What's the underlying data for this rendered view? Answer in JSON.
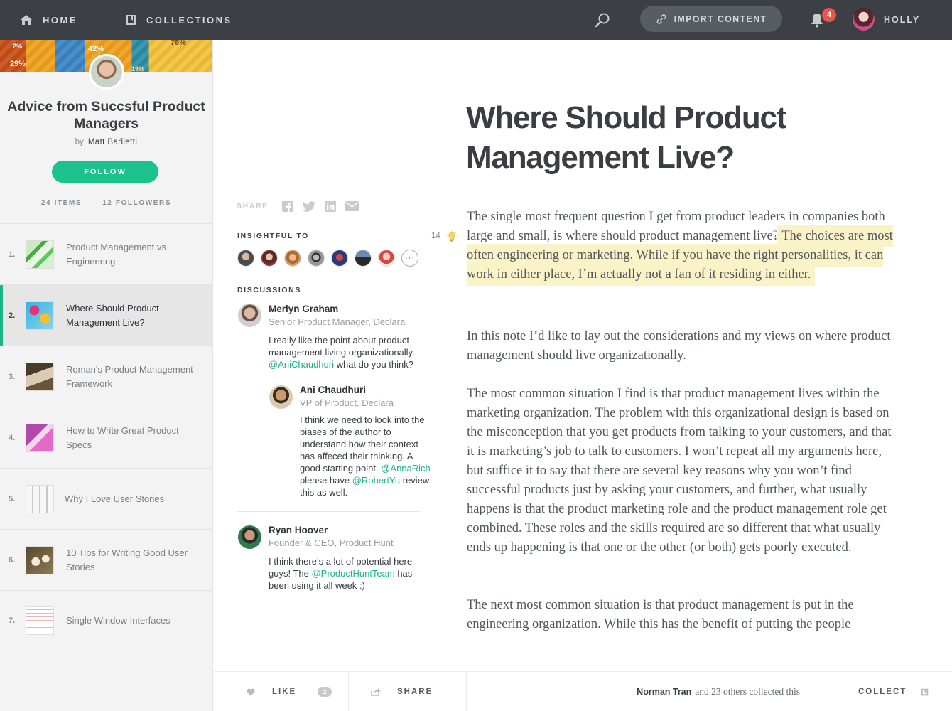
{
  "nav": {
    "home_label": "HOME",
    "collections_label": "COLLECTIONS",
    "import_label": "IMPORT CONTENT",
    "notification_count": "4",
    "user_name": "HOLLY"
  },
  "sidebar": {
    "cover_text": {
      "a": "2%",
      "b": "42%",
      "c": "29%",
      "d": "76%",
      "e": "19%"
    },
    "title": "Advice from Succsful Product Managers",
    "by_label": "by",
    "author": "Matt Bariletti",
    "follow_label": "FOLLOW",
    "items_count": "24 ITEMS",
    "followers_count": "12 FOLLOWERS",
    "items": [
      {
        "num": "1.",
        "label": "Product Management vs Engineering"
      },
      {
        "num": "2.",
        "label": "Where Should Product Management Live?"
      },
      {
        "num": "3.",
        "label": "Roman's Product Management Framework"
      },
      {
        "num": "4.",
        "label": "How to Write Great Product Specs"
      },
      {
        "num": "5.",
        "label": "Why I Love User Stories"
      },
      {
        "num": "6.",
        "label": "10 Tips for Writing Good User Stories"
      },
      {
        "num": "7.",
        "label": "Single Window Interfaces"
      }
    ]
  },
  "middle": {
    "share_label": "SHARE",
    "insightful_label": "INSIGHTFUL TO",
    "insight_count": "14",
    "more_label": "···",
    "discussions_label": "DISCUSSIONS",
    "comments": [
      {
        "name": "Merlyn Graham",
        "role": "Senior Product Manager, Declara",
        "text_before": "I really like the point about product management living organizationally. ",
        "mention1": "@AniChaudhuri",
        "text_after": " what do you think?"
      },
      {
        "name": "Ani Chaudhuri",
        "role": "VP of Product, Declara",
        "text_before": "I think we need to look into the biases of the author to understand how their context has affeced their thinking. A good starting point. ",
        "mention1": "@AnnaRich",
        "text_mid": " please have ",
        "mention2": "@RobertYu",
        "text_after": " review this as well."
      },
      {
        "name": "Ryan Hoover",
        "role": "Founder & CEO, Product Hunt",
        "text_before": "I think there’s a lot of potential here guys! The ",
        "mention1": "@ProductHuntTeam",
        "text_after": " has been using it all week :)"
      }
    ]
  },
  "article": {
    "title": "Where Should Product Management Live?",
    "p1_plain": "The single most frequent question I get from product leaders in companies both large and small, is where should product management live? ",
    "p1_highlight": "The choices are most often engineering or marketing. While if you have the right personalities, it can work in either place, I’m actually not a fan of it residing in either.",
    "p2": "In this note I’d like to lay out the considerations and my views on where product management should live organizationally.",
    "p3": "The most common situation I find is that product management lives within the marketing organization. The problem with this organizational design is based on the misconception that you get products from talking to your customers, and that it is marketing’s job to talk to customers. I won’t repeat all my arguments here, but suffice it to say that there are several key reasons why you won’t find successful products just by asking your customers, and further, what usually happens is that the product marketing role and the product management role get combined. These roles and the skills required are so different that what usually ends up happening is that one or the other (or both) gets poorly executed.",
    "p4": "The next most common situation is that product management is put in the engineering organization. While this has the benefit of putting the people"
  },
  "footer": {
    "like_label": "LIKE",
    "like_count": "2",
    "share_label": "SHARE",
    "collector": "Norman Tran",
    "collected_text": "and 23 others collected this",
    "collect_label": "COLLECT"
  },
  "colors": {
    "accent": "#1cc28c",
    "topbar": "#3c4044",
    "highlight": "#fbf3c8",
    "badge": "#e8544e"
  }
}
